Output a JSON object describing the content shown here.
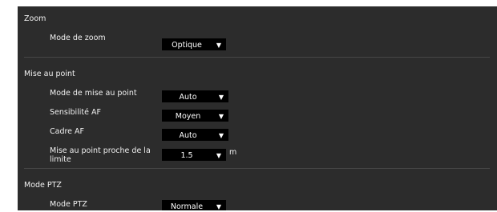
{
  "sections": {
    "zoom": {
      "title": "Zoom",
      "zoom_mode": {
        "label": "Mode de zoom",
        "value": "Optique"
      }
    },
    "focus": {
      "title": "Mise au point",
      "focus_mode": {
        "label": "Mode de mise au point",
        "value": "Auto"
      },
      "af_sensitivity": {
        "label": "Sensibilité AF",
        "value": "Moyen"
      },
      "af_frame": {
        "label": "Cadre AF",
        "value": "Auto"
      },
      "near_limit": {
        "label": "Mise au point proche de la limite",
        "value": "1.5",
        "unit": "m"
      }
    },
    "ptz": {
      "title": "Mode PTZ",
      "ptz_mode": {
        "label": "Mode PTZ",
        "value": "Normale"
      }
    }
  },
  "icons": {
    "dropdown_arrow": "▼"
  }
}
